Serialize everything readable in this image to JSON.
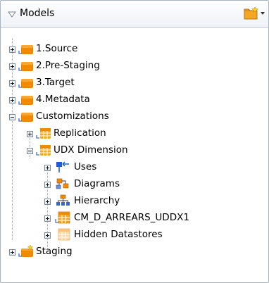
{
  "panel": {
    "title": "Models",
    "toggle_icon": "triangle-down-icon",
    "action_icon": "folder-star-icon"
  },
  "tree": {
    "items": [
      {
        "label": "1.Source",
        "level": 0,
        "expanded": false,
        "icon": "model-folder-icon"
      },
      {
        "label": "2.Pre-Staging",
        "level": 0,
        "expanded": false,
        "icon": "model-folder-icon"
      },
      {
        "label": "3.Target",
        "level": 0,
        "expanded": false,
        "icon": "model-folder-icon"
      },
      {
        "label": "4.Metadata",
        "level": 0,
        "expanded": false,
        "icon": "model-folder-icon"
      },
      {
        "label": "Customizations",
        "level": 0,
        "expanded": true,
        "icon": "model-folder-icon"
      },
      {
        "label": "Replication",
        "level": 1,
        "expanded": false,
        "icon": "model-icon"
      },
      {
        "label": "UDX Dimension",
        "level": 1,
        "expanded": true,
        "icon": "model-icon"
      },
      {
        "label": "Uses",
        "level": 2,
        "expanded": false,
        "icon": "uses-icon"
      },
      {
        "label": "Diagrams",
        "level": 2,
        "expanded": false,
        "icon": "diagrams-icon"
      },
      {
        "label": "Hierarchy",
        "level": 2,
        "expanded": false,
        "icon": "hierarchy-icon"
      },
      {
        "label": "CM_D_ARREARS_UDDX1",
        "level": 2,
        "expanded": false,
        "icon": "datastore-icon"
      },
      {
        "label": "Hidden Datastores",
        "level": 2,
        "expanded": false,
        "icon": "hidden-datastores-icon"
      },
      {
        "label": "Staging",
        "level": 0,
        "expanded": false,
        "icon": "model-folder-star-icon"
      }
    ]
  },
  "colors": {
    "folder_orange": "#f08a00",
    "header_bg": "#eef2f7",
    "border": "#a9b4c2"
  }
}
